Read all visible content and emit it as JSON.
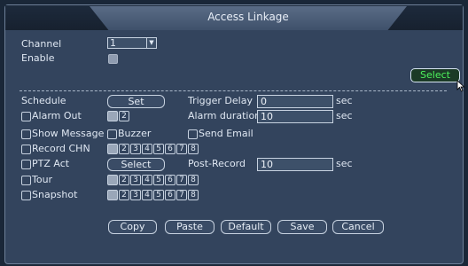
{
  "window": {
    "title": "Access Linkage"
  },
  "channel": {
    "label": "Channel",
    "value": "1"
  },
  "enable": {
    "label": "Enable"
  },
  "select_top": {
    "label": "Select"
  },
  "schedule": {
    "label": "Schedule",
    "button": "Set"
  },
  "trigger_delay": {
    "label": "Trigger Delay",
    "value": "0",
    "unit": "sec"
  },
  "alarm_out": {
    "label": "Alarm Out",
    "boxes": [
      "1",
      "2"
    ],
    "active": [
      true,
      false
    ]
  },
  "alarm_duration": {
    "label": "Alarm duration",
    "value": "10",
    "unit": "sec"
  },
  "show_message": {
    "label": "Show Message"
  },
  "buzzer": {
    "label": "Buzzer"
  },
  "send_email": {
    "label": "Send Email"
  },
  "record_chn": {
    "label": "Record CHN",
    "boxes": [
      "1",
      "2",
      "3",
      "4",
      "5",
      "6",
      "7",
      "8"
    ],
    "active": [
      true,
      false,
      false,
      false,
      false,
      false,
      false,
      false
    ]
  },
  "ptz_act": {
    "label": "PTZ Act",
    "button": "Select"
  },
  "post_record": {
    "label": "Post-Record",
    "value": "10",
    "unit": "sec"
  },
  "tour": {
    "label": "Tour",
    "boxes": [
      "1",
      "2",
      "3",
      "4",
      "5",
      "6",
      "7",
      "8"
    ],
    "active": [
      true,
      false,
      false,
      false,
      false,
      false,
      false,
      false
    ]
  },
  "snapshot": {
    "label": "Snapshot",
    "boxes": [
      "1",
      "2",
      "3",
      "4",
      "5",
      "6",
      "7",
      "8"
    ],
    "active": [
      true,
      false,
      false,
      false,
      false,
      false,
      false,
      false
    ]
  },
  "footer": {
    "copy": "Copy",
    "paste": "Paste",
    "default": "Default",
    "save": "Save",
    "cancel": "Cancel"
  },
  "colors": {
    "panel": "#33445d",
    "select_text": "#4df25d",
    "border": "#c7d2e0"
  }
}
